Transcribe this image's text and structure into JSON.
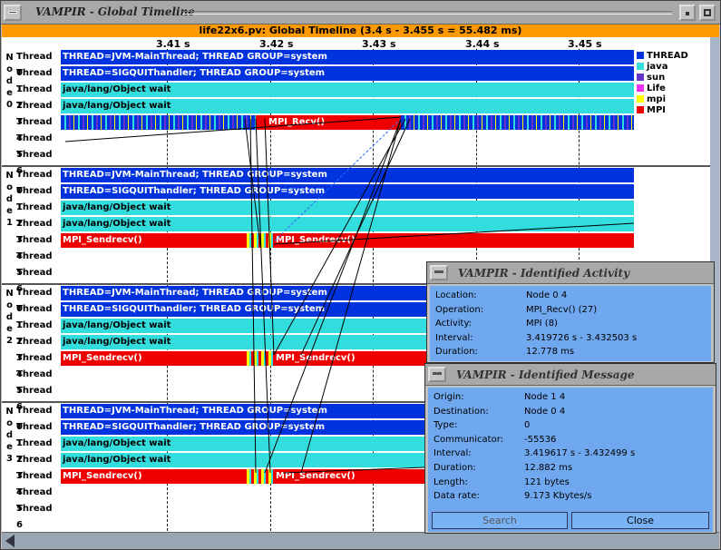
{
  "window": {
    "title": "VAMPIR - Global Timeline"
  },
  "timeline": {
    "header": "life22x6.pv: Global Timeline (3.4 s - 3.455 s = 55.482 ms)",
    "ticks": [
      "3.41 s",
      "3.42 s",
      "3.43 s",
      "3.44 s",
      "3.45 s"
    ],
    "node_labels": [
      "N",
      "o",
      "d",
      "e"
    ],
    "nodes": [
      {
        "number": "0",
        "threads": [
          {
            "label": "Thread 0",
            "activity": "THREAD=JVM-MainThread; THREAD GROUP=system",
            "kind": "thread"
          },
          {
            "label": "Thread 1",
            "activity": "THREAD=SIGQUIThandler; THREAD GROUP=system",
            "kind": "thread"
          },
          {
            "label": "Thread 2",
            "activity": "java/lang/Object wait",
            "kind": "java"
          },
          {
            "label": "Thread 3",
            "activity": "java/lang/Object wait",
            "kind": "java"
          },
          {
            "label": "Thread 4",
            "activity": "MPI_Recv()",
            "kind": "mpi4"
          },
          {
            "label": "Thread 5",
            "activity": "",
            "kind": "none"
          },
          {
            "label": "Thread 6",
            "activity": "",
            "kind": "none"
          }
        ]
      },
      {
        "number": "1",
        "threads": [
          {
            "label": "Thread 0",
            "activity": "THREAD=JVM-MainThread; THREAD GROUP=system",
            "kind": "thread"
          },
          {
            "label": "Thread 1",
            "activity": "THREAD=SIGQUIThandler; THREAD GROUP=system",
            "kind": "thread"
          },
          {
            "label": "Thread 2",
            "activity": "java/lang/Object wait",
            "kind": "java"
          },
          {
            "label": "Thread 3",
            "activity": "java/lang/Object wait",
            "kind": "java"
          },
          {
            "label": "Thread 4",
            "activity": "MPI_Sendrecv()",
            "kind": "mpi",
            "activity2": "MPI_Sendrecv()"
          },
          {
            "label": "Thread 5",
            "activity": "",
            "kind": "none"
          },
          {
            "label": "Thread 6",
            "activity": "",
            "kind": "none"
          }
        ]
      },
      {
        "number": "2",
        "threads": [
          {
            "label": "Thread 0",
            "activity": "THREAD=JVM-MainThread; THREAD GROUP=system",
            "kind": "thread"
          },
          {
            "label": "Thread 1",
            "activity": "THREAD=SIGQUIThandler; THREAD GROUP=system",
            "kind": "thread"
          },
          {
            "label": "Thread 2",
            "activity": "java/lang/Object wait",
            "kind": "java"
          },
          {
            "label": "Thread 3",
            "activity": "java/lang/Object wait",
            "kind": "java"
          },
          {
            "label": "Thread 4",
            "activity": "MPI_Sendrecv()",
            "kind": "mpi",
            "activity2": "MPI_Sendrecv()"
          },
          {
            "label": "Thread 5",
            "activity": "",
            "kind": "none"
          },
          {
            "label": "Thread 6",
            "activity": "",
            "kind": "none"
          }
        ]
      },
      {
        "number": "3",
        "threads": [
          {
            "label": "Thread 0",
            "activity": "THREAD=JVM-MainThread; THREAD GROUP=system",
            "kind": "thread"
          },
          {
            "label": "Thread 1",
            "activity": "THREAD=SIGQUIThandler; THREAD GROUP=system",
            "kind": "thread"
          },
          {
            "label": "Thread 2",
            "activity": "java/lang/Object wait",
            "kind": "java"
          },
          {
            "label": "Thread 3",
            "activity": "java/lang/Object wait",
            "kind": "java"
          },
          {
            "label": "Thread 4",
            "activity": "MPI_Sendrecv()",
            "kind": "mpi",
            "activity2": "MPI_Sendrecv()"
          },
          {
            "label": "Thread 5",
            "activity": "",
            "kind": "none"
          },
          {
            "label": "Thread 6",
            "activity": "",
            "kind": "none"
          }
        ]
      }
    ],
    "legend": [
      {
        "label": "THREAD",
        "color": "#0033dd"
      },
      {
        "label": "java",
        "color": "#33dddd"
      },
      {
        "label": "sun",
        "color": "#6633cc"
      },
      {
        "label": "Life",
        "color": "#ee33ee"
      },
      {
        "label": "mpi",
        "color": "#ffff00"
      },
      {
        "label": "MPI",
        "color": "#ee0000"
      }
    ]
  },
  "colors": {
    "thread": "#0033dd",
    "java": "#33dddd",
    "mpi": "#ee0000",
    "header": "#ff9900",
    "dialog": "#6fa8ee"
  },
  "activity_dialog": {
    "title": "VAMPIR - Identified Activity",
    "rows": [
      {
        "key": "Location:",
        "value": "Node 0 4"
      },
      {
        "key": "Operation:",
        "value": "MPI_Recv() (27)"
      },
      {
        "key": "Activity:",
        "value": "MPI (8)"
      },
      {
        "key": "Interval:",
        "value": "3.419726 s - 3.432503 s"
      },
      {
        "key": "Duration:",
        "value": "12.778 ms"
      }
    ]
  },
  "message_dialog": {
    "title": "VAMPIR - Identified Message",
    "rows": [
      {
        "key": "Origin:",
        "value": "Node 1 4"
      },
      {
        "key": "Destination:",
        "value": "Node 0 4"
      },
      {
        "key": "Type:",
        "value": "0"
      },
      {
        "key": "Communicator:",
        "value": "-55536"
      },
      {
        "key": "Interval:",
        "value": "3.419617 s - 3.432499 s"
      },
      {
        "key": "Duration:",
        "value": "12.882 ms"
      },
      {
        "key": "Length:",
        "value": "121 bytes"
      },
      {
        "key": "Data rate:",
        "value": "9.173 Kbytes/s"
      }
    ],
    "search_label": "Search",
    "close_label": "Close"
  }
}
